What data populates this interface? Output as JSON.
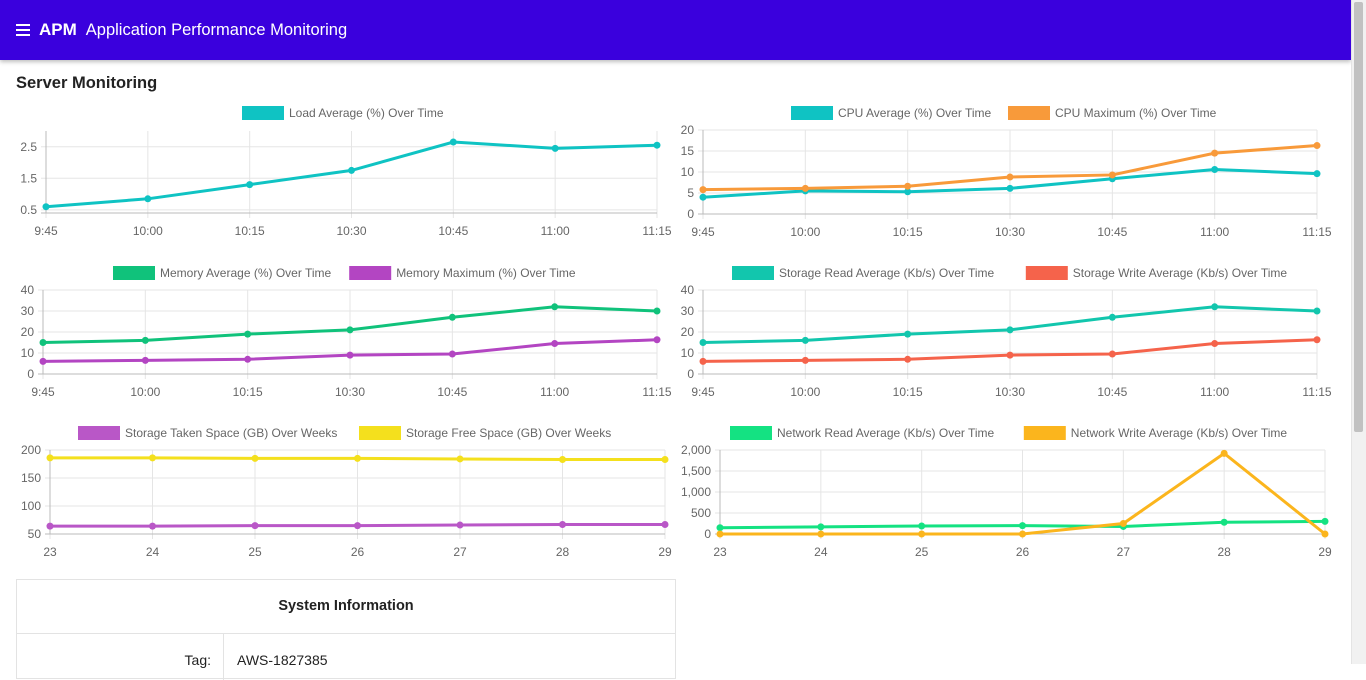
{
  "header": {
    "brand": "APM",
    "title": "Application Performance Monitoring"
  },
  "page": {
    "title": "Server Monitoring"
  },
  "charts": [
    {
      "type": "line",
      "x": [
        "9:45",
        "10:00",
        "10:15",
        "10:30",
        "10:45",
        "11:00",
        "11:15"
      ],
      "yticks": [
        "0.5",
        "1.5",
        "2.5"
      ],
      "ylim": [
        0.4,
        3.0
      ],
      "series": [
        {
          "name": "Load Average (%) Over Time",
          "color": "#0fc3c3",
          "values": [
            0.6,
            0.85,
            1.3,
            1.75,
            2.65,
            2.45,
            2.55
          ]
        }
      ]
    },
    {
      "type": "line",
      "x": [
        "9:45",
        "10:00",
        "10:15",
        "10:30",
        "10:45",
        "11:00",
        "11:15"
      ],
      "yticks": [
        "0",
        "5",
        "10",
        "15",
        "20"
      ],
      "ylim": [
        0,
        20
      ],
      "series": [
        {
          "name": "CPU Average (%) Over Time",
          "color": "#0fc3c3",
          "values": [
            4,
            5.5,
            5.3,
            6.1,
            8.4,
            10.6,
            9.6
          ]
        },
        {
          "name": "CPU Maximum (%) Over Time",
          "color": "#f89a3a",
          "values": [
            5.8,
            6.1,
            6.6,
            8.8,
            9.3,
            14.5,
            16.3
          ]
        }
      ]
    },
    {
      "type": "line",
      "x": [
        "9:45",
        "10:00",
        "10:15",
        "10:30",
        "10:45",
        "11:00",
        "11:15"
      ],
      "yticks": [
        "0",
        "10",
        "20",
        "30",
        "40"
      ],
      "ylim": [
        0,
        40
      ],
      "series": [
        {
          "name": "Memory Average (%) Over Time",
          "color": "#10c27b",
          "values": [
            15,
            16,
            19,
            21,
            27,
            32,
            30
          ]
        },
        {
          "name": "Memory Maximum (%) Over Time",
          "color": "#b345c2",
          "values": [
            6,
            6.5,
            7,
            9,
            9.5,
            14.5,
            16.3
          ]
        }
      ]
    },
    {
      "type": "line",
      "x": [
        "9:45",
        "10:00",
        "10:15",
        "10:30",
        "10:45",
        "11:00",
        "11:15"
      ],
      "yticks": [
        "0",
        "10",
        "20",
        "30",
        "40"
      ],
      "ylim": [
        0,
        40
      ],
      "series": [
        {
          "name": "Storage Read Average (Kb/s) Over Time",
          "color": "#12c6ad",
          "values": [
            15,
            16,
            19,
            21,
            27,
            32,
            30
          ]
        },
        {
          "name": "Storage Write Average (Kb/s) Over Time",
          "color": "#f5634b",
          "values": [
            6,
            6.5,
            7,
            9,
            9.5,
            14.5,
            16.3
          ]
        }
      ]
    },
    {
      "type": "line",
      "x": [
        "23",
        "24",
        "25",
        "26",
        "27",
        "28",
        "29"
      ],
      "yticks": [
        "50",
        "100",
        "150",
        "200"
      ],
      "ylim": [
        50,
        200
      ],
      "series": [
        {
          "name": "Storage Taken Space (GB) Over Weeks",
          "color": "#b957c7",
          "values": [
            64,
            64,
            65,
            65,
            66,
            67,
            67
          ]
        },
        {
          "name": "Storage Free Space (GB) Over Weeks",
          "color": "#f4e01d",
          "values": [
            186,
            186,
            185,
            185,
            184,
            183,
            183
          ]
        }
      ]
    },
    {
      "type": "line",
      "x": [
        "23",
        "24",
        "25",
        "26",
        "27",
        "28",
        "29"
      ],
      "yticks": [
        "0",
        "500",
        "1,000",
        "1,500",
        "2,000"
      ],
      "ylim": [
        0,
        2000
      ],
      "series": [
        {
          "name": "Network Read Average (Kb/s) Over Time",
          "color": "#14e282",
          "values": [
            150,
            170,
            190,
            200,
            180,
            280,
            300
          ]
        },
        {
          "name": "Network Write Average (Kb/s) Over Time",
          "color": "#fbb51d",
          "values": [
            0,
            0,
            0,
            0,
            250,
            1920,
            0
          ]
        }
      ]
    }
  ],
  "system_info": {
    "title": "System Information",
    "rows": [
      {
        "key": "Tag:",
        "value": "AWS-1827385"
      }
    ]
  }
}
